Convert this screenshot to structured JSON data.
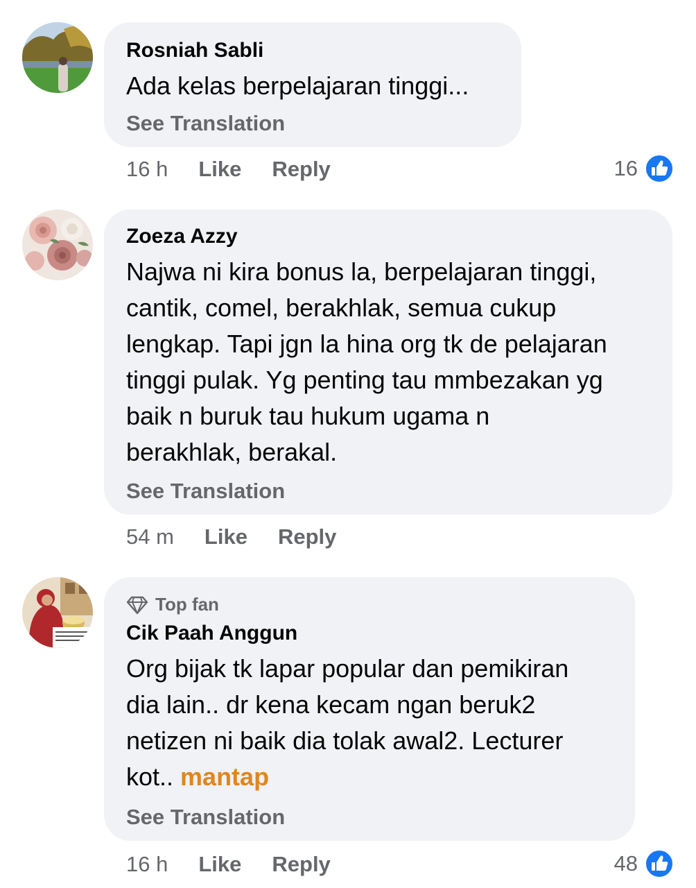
{
  "colors": {
    "bubble": "#f0f2f5",
    "text": "#050505",
    "meta": "#65676b",
    "like_blue": "#1877f2",
    "highlight": "#e0861e"
  },
  "comments": [
    {
      "author": "Rosniah Sabli",
      "avatar_icon": "avatar-photo-park",
      "lines": [
        "Ada kelas berpelajaran tinggi..."
      ],
      "see_translation": "See Translation",
      "time": "16 h",
      "like_label": "Like",
      "reply_label": "Reply",
      "reaction_count": "16",
      "reaction_icon": "thumbs-up-icon"
    },
    {
      "author": "Zoeza Azzy",
      "avatar_icon": "avatar-photo-roses",
      "lines": [
        "Najwa ni kira bonus la, berpelajaran tinggi,",
        "cantik, comel, berakhlak, semua cukup",
        "lengkap. Tapi jgn la hina org tk de pelajaran",
        "tinggi pulak. Yg penting tau mmbezakan yg",
        "baik n buruk tau hukum ugama n",
        "berakhlak, berakal."
      ],
      "see_translation": "See Translation",
      "time": "54 m",
      "like_label": "Like",
      "reply_label": "Reply"
    },
    {
      "badge": "Top fan",
      "badge_icon": "diamond-icon",
      "author": "Cik Paah Anggun",
      "avatar_icon": "avatar-photo-baking",
      "lines": [
        "Org bijak tk lapar popular dan pemikiran",
        "dia lain.. dr kena kecam ngan beruk2",
        "netizen ni baik dia tolak awal2. Lecturer"
      ],
      "last_line_prefix": "kot.. ",
      "last_line_highlight": "mantap",
      "see_translation": "See Translation",
      "time": "16 h",
      "like_label": "Like",
      "reply_label": "Reply",
      "reaction_count": "48",
      "reaction_icon": "thumbs-up-icon"
    }
  ]
}
